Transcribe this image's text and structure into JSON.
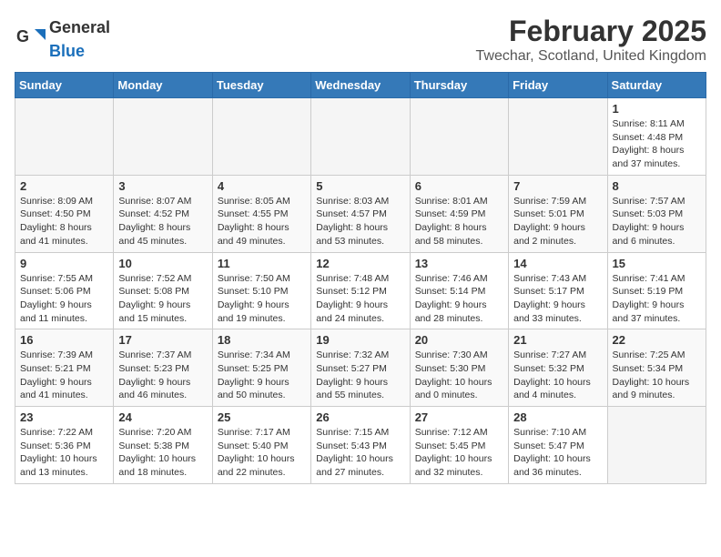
{
  "header": {
    "logo_general": "General",
    "logo_blue": "Blue",
    "title": "February 2025",
    "subtitle": "Twechar, Scotland, United Kingdom"
  },
  "days_of_week": [
    "Sunday",
    "Monday",
    "Tuesday",
    "Wednesday",
    "Thursday",
    "Friday",
    "Saturday"
  ],
  "weeks": [
    [
      {
        "day": "",
        "detail": ""
      },
      {
        "day": "",
        "detail": ""
      },
      {
        "day": "",
        "detail": ""
      },
      {
        "day": "",
        "detail": ""
      },
      {
        "day": "",
        "detail": ""
      },
      {
        "day": "",
        "detail": ""
      },
      {
        "day": "1",
        "detail": "Sunrise: 8:11 AM\nSunset: 4:48 PM\nDaylight: 8 hours and 37 minutes."
      }
    ],
    [
      {
        "day": "2",
        "detail": "Sunrise: 8:09 AM\nSunset: 4:50 PM\nDaylight: 8 hours and 41 minutes."
      },
      {
        "day": "3",
        "detail": "Sunrise: 8:07 AM\nSunset: 4:52 PM\nDaylight: 8 hours and 45 minutes."
      },
      {
        "day": "4",
        "detail": "Sunrise: 8:05 AM\nSunset: 4:55 PM\nDaylight: 8 hours and 49 minutes."
      },
      {
        "day": "5",
        "detail": "Sunrise: 8:03 AM\nSunset: 4:57 PM\nDaylight: 8 hours and 53 minutes."
      },
      {
        "day": "6",
        "detail": "Sunrise: 8:01 AM\nSunset: 4:59 PM\nDaylight: 8 hours and 58 minutes."
      },
      {
        "day": "7",
        "detail": "Sunrise: 7:59 AM\nSunset: 5:01 PM\nDaylight: 9 hours and 2 minutes."
      },
      {
        "day": "8",
        "detail": "Sunrise: 7:57 AM\nSunset: 5:03 PM\nDaylight: 9 hours and 6 minutes."
      }
    ],
    [
      {
        "day": "9",
        "detail": "Sunrise: 7:55 AM\nSunset: 5:06 PM\nDaylight: 9 hours and 11 minutes."
      },
      {
        "day": "10",
        "detail": "Sunrise: 7:52 AM\nSunset: 5:08 PM\nDaylight: 9 hours and 15 minutes."
      },
      {
        "day": "11",
        "detail": "Sunrise: 7:50 AM\nSunset: 5:10 PM\nDaylight: 9 hours and 19 minutes."
      },
      {
        "day": "12",
        "detail": "Sunrise: 7:48 AM\nSunset: 5:12 PM\nDaylight: 9 hours and 24 minutes."
      },
      {
        "day": "13",
        "detail": "Sunrise: 7:46 AM\nSunset: 5:14 PM\nDaylight: 9 hours and 28 minutes."
      },
      {
        "day": "14",
        "detail": "Sunrise: 7:43 AM\nSunset: 5:17 PM\nDaylight: 9 hours and 33 minutes."
      },
      {
        "day": "15",
        "detail": "Sunrise: 7:41 AM\nSunset: 5:19 PM\nDaylight: 9 hours and 37 minutes."
      }
    ],
    [
      {
        "day": "16",
        "detail": "Sunrise: 7:39 AM\nSunset: 5:21 PM\nDaylight: 9 hours and 41 minutes."
      },
      {
        "day": "17",
        "detail": "Sunrise: 7:37 AM\nSunset: 5:23 PM\nDaylight: 9 hours and 46 minutes."
      },
      {
        "day": "18",
        "detail": "Sunrise: 7:34 AM\nSunset: 5:25 PM\nDaylight: 9 hours and 50 minutes."
      },
      {
        "day": "19",
        "detail": "Sunrise: 7:32 AM\nSunset: 5:27 PM\nDaylight: 9 hours and 55 minutes."
      },
      {
        "day": "20",
        "detail": "Sunrise: 7:30 AM\nSunset: 5:30 PM\nDaylight: 10 hours and 0 minutes."
      },
      {
        "day": "21",
        "detail": "Sunrise: 7:27 AM\nSunset: 5:32 PM\nDaylight: 10 hours and 4 minutes."
      },
      {
        "day": "22",
        "detail": "Sunrise: 7:25 AM\nSunset: 5:34 PM\nDaylight: 10 hours and 9 minutes."
      }
    ],
    [
      {
        "day": "23",
        "detail": "Sunrise: 7:22 AM\nSunset: 5:36 PM\nDaylight: 10 hours and 13 minutes."
      },
      {
        "day": "24",
        "detail": "Sunrise: 7:20 AM\nSunset: 5:38 PM\nDaylight: 10 hours and 18 minutes."
      },
      {
        "day": "25",
        "detail": "Sunrise: 7:17 AM\nSunset: 5:40 PM\nDaylight: 10 hours and 22 minutes."
      },
      {
        "day": "26",
        "detail": "Sunrise: 7:15 AM\nSunset: 5:43 PM\nDaylight: 10 hours and 27 minutes."
      },
      {
        "day": "27",
        "detail": "Sunrise: 7:12 AM\nSunset: 5:45 PM\nDaylight: 10 hours and 32 minutes."
      },
      {
        "day": "28",
        "detail": "Sunrise: 7:10 AM\nSunset: 5:47 PM\nDaylight: 10 hours and 36 minutes."
      },
      {
        "day": "",
        "detail": ""
      }
    ]
  ]
}
